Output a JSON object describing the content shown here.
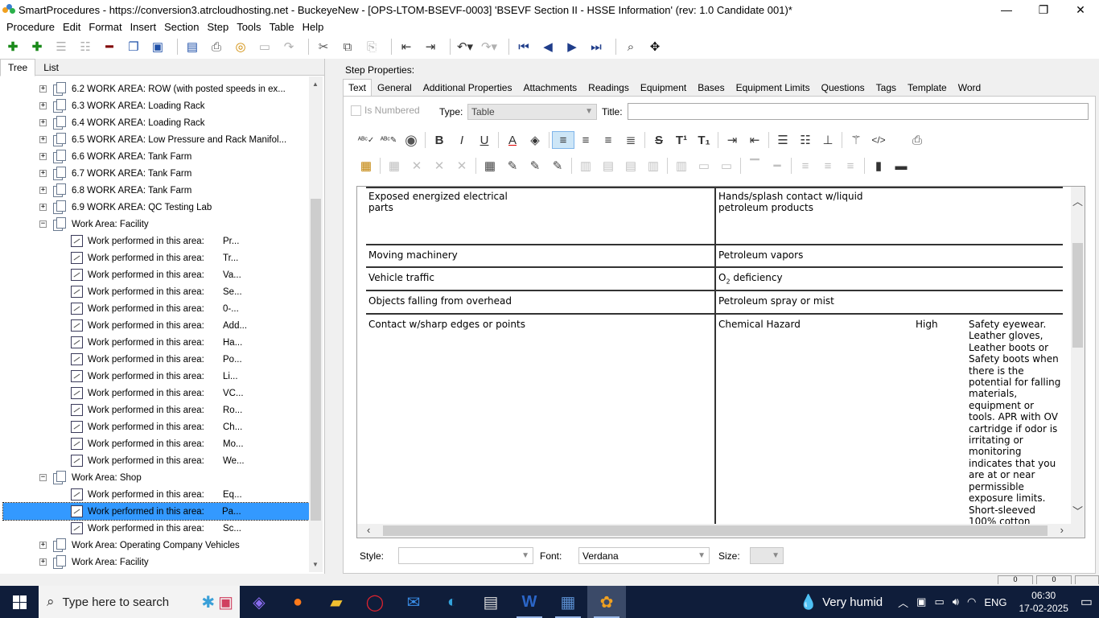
{
  "window": {
    "title": "SmartProcedures - https://conversion3.atrcloudhosting.net - BuckeyeNew - [OPS-LTOM-BSEVF-0003] 'BSEVF Section II - HSSE Information' (rev: 1.0 Candidate 001)*",
    "minimize": "—",
    "maximize": "❐",
    "close": "✕"
  },
  "menu": [
    "Procedure",
    "Edit",
    "Format",
    "Insert",
    "Section",
    "Step",
    "Tools",
    "Table",
    "Help"
  ],
  "left_tabs": [
    "Tree",
    "List"
  ],
  "tree": {
    "items": [
      {
        "label": "6.2 WORK AREA: ROW (with posted speeds in ex...",
        "suffix": ""
      },
      {
        "label": "6.3 WORK AREA: Loading Rack",
        "suffix": ""
      },
      {
        "label": "6.4 WORK AREA: Loading Rack",
        "suffix": ""
      },
      {
        "label": "6.5 WORK AREA: Low Pressure and Rack Manifol...",
        "suffix": ""
      },
      {
        "label": "6.6 WORK AREA: Tank Farm",
        "suffix": ""
      },
      {
        "label": "6.7 WORK AREA: Tank Farm",
        "suffix": ""
      },
      {
        "label": "6.8 WORK AREA: Tank Farm",
        "suffix": ""
      },
      {
        "label": "6.9 WORK AREA: QC Testing Lab",
        "suffix": ""
      },
      {
        "label": "Work Area: Facility",
        "suffix": ""
      },
      {
        "label": "Work performed in this area:",
        "suffix": "Pr..."
      },
      {
        "label": "Work performed in this area:",
        "suffix": "Tr..."
      },
      {
        "label": "Work performed in this area:",
        "suffix": "Va..."
      },
      {
        "label": "Work performed in this area:",
        "suffix": "Se..."
      },
      {
        "label": "Work performed in this area:",
        "suffix": "0-..."
      },
      {
        "label": "Work performed in this area:",
        "suffix": "Add..."
      },
      {
        "label": "Work performed in this area:",
        "suffix": "Ha..."
      },
      {
        "label": "Work performed in this area:",
        "suffix": "Po..."
      },
      {
        "label": "Work performed in this area:",
        "suffix": "Li..."
      },
      {
        "label": "Work performed in this area:",
        "suffix": "VC..."
      },
      {
        "label": "Work performed in this area:",
        "suffix": "Ro..."
      },
      {
        "label": "Work performed in this area:",
        "suffix": "Ch..."
      },
      {
        "label": "Work performed in this area:",
        "suffix": "Mo..."
      },
      {
        "label": "Work performed in this area:",
        "suffix": "We..."
      },
      {
        "label": "Work Area: Shop",
        "suffix": ""
      },
      {
        "label": "Work performed in this area:",
        "suffix": "Eq..."
      },
      {
        "label": "Work performed in this area:",
        "suffix": "Pa..."
      },
      {
        "label": "Work performed in this area:",
        "suffix": "Sc..."
      },
      {
        "label": "Work Area: Operating Company Vehicles",
        "suffix": ""
      },
      {
        "label": "Work Area: Facility",
        "suffix": ""
      }
    ]
  },
  "step_properties": {
    "label": "Step Properties:",
    "tabs": [
      "Text",
      "General",
      "Additional Properties",
      "Attachments",
      "Readings",
      "Equipment",
      "Bases",
      "Equipment Limits",
      "Questions",
      "Tags",
      "Template",
      "Word"
    ],
    "is_numbered": "Is Numbered",
    "type_label": "Type:",
    "type_value": "Table",
    "title_label": "Title:",
    "title_value": ""
  },
  "table": {
    "r1": {
      "left": "Exposed energized electrical parts",
      "right": "Hands/splash contact w/liquid petroleum products"
    },
    "r2": {
      "left": "Moving machinery",
      "right": "Petroleum vapors"
    },
    "r3": {
      "left": "Vehicle traffic",
      "right_main": "O",
      "right_sub": "2",
      "right_rest": " deficiency"
    },
    "r4": {
      "left": "Objects falling from overhead",
      "right": "Petroleum spray or mist"
    },
    "r5": {
      "left": "Contact w/sharp edges or points",
      "right": "Chemical Hazard",
      "level": "High",
      "control": "Safety eyewear. Leather gloves, Leather boots or Safety boots when there is the potential for falling materials, equipment or tools. APR with OV cartridge if odor is irritating or monitoring indicates that you are at or near permissible exposure limits. Short-sleeved 100% cotton"
    }
  },
  "bottom": {
    "style_label": "Style:",
    "style_value": "",
    "font_label": "Font:",
    "font_value": "Verdana",
    "size_label": "Size:",
    "size_value": ""
  },
  "status": {
    "box1": "0",
    "box2": "0"
  },
  "taskbar": {
    "search_placeholder": "Type here to search",
    "weather": "Very humid",
    "language": "ENG",
    "time": "06:30",
    "date": "17-02-2025"
  },
  "colors": {
    "selection": "#3399ff",
    "taskbar": "#0f1d3a",
    "tab_active": "#ffffff"
  }
}
